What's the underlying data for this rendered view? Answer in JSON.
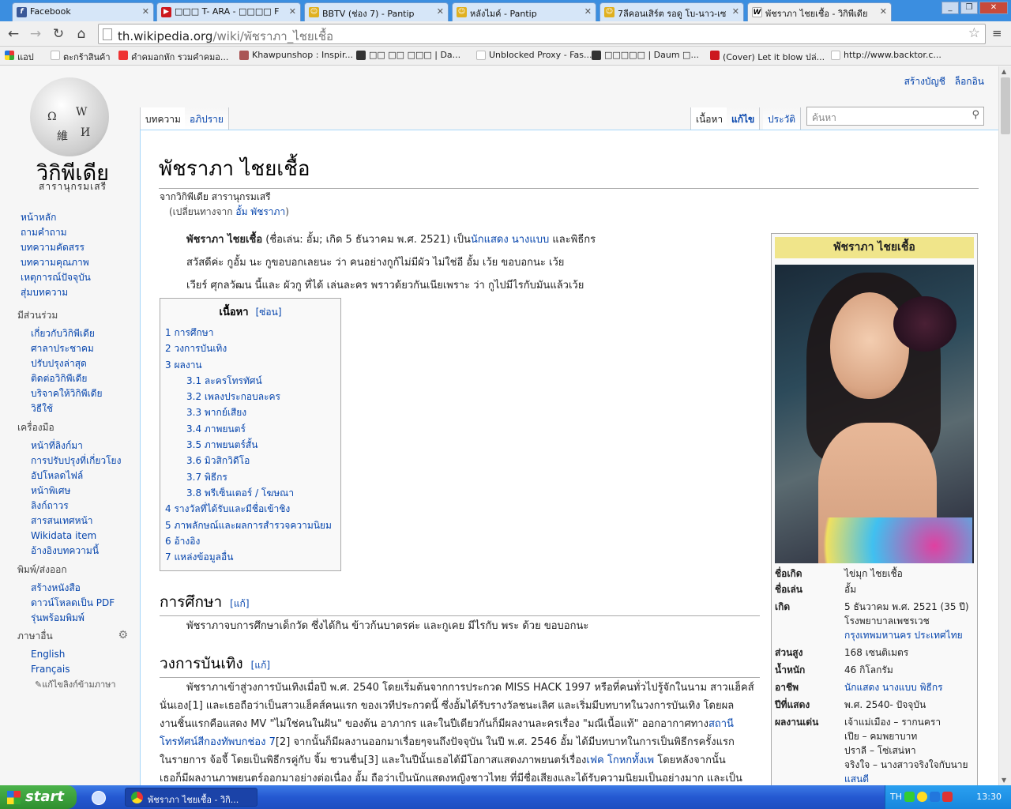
{
  "browser": {
    "tabs": [
      {
        "title": "Facebook",
        "icon": "facebook-icon",
        "color": "#3b5998",
        "glyph": "f"
      },
      {
        "title": "□□□ T- ARA - □□□□ F",
        "icon": "youtube-icon",
        "color": "#cc181e",
        "glyph": "▶"
      },
      {
        "title": "BBTV (ช่อง 7) - Pantip",
        "icon": "pantip-icon",
        "color": "#e0b020",
        "glyph": "☺"
      },
      {
        "title": "หลังไมค์ - Pantip",
        "icon": "pantip-icon",
        "color": "#e0b020",
        "glyph": "☺"
      },
      {
        "title": "7ลีคอนเสิร์ต รอดู โบ-นาว-เซ",
        "icon": "pantip-icon",
        "color": "#e0b020",
        "glyph": "☺"
      },
      {
        "title": "พัชราภา ไชยเชื้อ - วิกิพีเดีย",
        "icon": "wikipedia-icon",
        "color": "#ffffff",
        "glyph": "W"
      }
    ],
    "url_host": "th.wikipedia.org",
    "url_path": "/wiki/พัชราภา_ไชยเชื้อ",
    "bookmarks": [
      {
        "label": "แอป",
        "color": "#e44"
      },
      {
        "label": "ตะกร้าสินค้า",
        "color": "#bbb"
      },
      {
        "label": "คำคมอกหัก รวมคำคมอ...",
        "color": "#e33"
      },
      {
        "label": "Khawpunshop : Inspir...",
        "color": "#a55"
      },
      {
        "label": "□□ □□ □□□ | Da...",
        "color": "#333"
      },
      {
        "label": "Unblocked Proxy - Fas...",
        "color": "#bbb"
      },
      {
        "label": "□□□□□ | Daum □...",
        "color": "#333"
      },
      {
        "label": "(Cover) Let it blow ปล่...",
        "color": "#cc181e"
      },
      {
        "label": "http://www.backtor.c...",
        "color": "#bbb"
      }
    ]
  },
  "wiki": {
    "wordmark": "วิกิพีเดีย",
    "tagline": "สารานุกรมเสรี",
    "personal": [
      "สร้างบัญชี",
      "ล็อกอิน"
    ],
    "tabs_left": [
      "บทความ",
      "อภิปราย"
    ],
    "tabs_right": [
      "เนื้อหา",
      "แก้ไข",
      "ประวัติ"
    ],
    "search_placeholder": "ค้นหา",
    "nav": [
      "หน้าหลัก",
      "ถามคำถาม",
      "บทความคัดสรร",
      "บทความคุณภาพ",
      "เหตุการณ์ปัจจุบัน",
      "สุ่มบทความ"
    ],
    "participate_heading": "มีส่วนร่วม",
    "participate": [
      "เกี่ยวกับวิกิพีเดีย",
      "ศาลาประชาคม",
      "ปรับปรุงล่าสุด",
      "ติดต่อวิกิพีเดีย",
      "บริจาคให้วิกิพีเดีย",
      "วิธีใช้"
    ],
    "tools_heading": "เครื่องมือ",
    "tools": [
      "หน้าที่ลิงก์มา",
      "การปรับปรุงที่เกี่ยวโยง",
      "อัปโหลดไฟล์",
      "หน้าพิเศษ",
      "ลิงก์ถาวร",
      "สารสนเทศหน้า",
      "Wikidata item",
      "อ้างอิงบทความนี้"
    ],
    "print_heading": "พิมพ์/ส่งออก",
    "print": [
      "สร้างหนังสือ",
      "ดาวน์โหลดเป็น PDF",
      "รุ่นพร้อมพิมพ์"
    ],
    "lang_heading": "ภาษาอื่น",
    "langs": [
      "English",
      "Français"
    ],
    "edit_links": "แก้ไขลิงก์ข้ามภาษา"
  },
  "article": {
    "title": "พัชราภา ไชยเชื้อ",
    "sitesub": "จากวิกิพีเดีย สารานุกรมเสรี",
    "redirect_prefix": "(เปลี่ยนทางจาก ",
    "redirect_link": "อั้ม พัชราภา",
    "redirect_suffix": ")",
    "lead1_bold": "พัชราภา ไชยเชื้อ",
    "lead1_a": " (ชื่อเล่น: อั้ม; เกิด 5 ธันวาคม พ.ศ. 2521) เป็น",
    "lead1_l1": "นักแสดง",
    "lead1_sp": " ",
    "lead1_l2": "นางแบบ",
    "lead1_b": " และพิธีกร",
    "lead2": "สวัสดีค่ะ กูอั้ม นะ กูขอบอกเลยนะ ว่า คนอย่างกูก้ไม่มีผัว ไม่ใช่อี อั้ม เว้ย ขอบอกนะ เว้ย",
    "lead3": "เวียร์ ศุกลวัฒน นี้และ ผัวกู ที่ได้ เล่นละคร พราวด้ยวกันเนียเพราะ ว่า กูไปมีไรกับมันแล้วเว้ย",
    "toc_title": "เนื้อหา",
    "toc_hide": "[ซ่อน]",
    "toc": [
      {
        "t": "1 การศึกษา",
        "s": false
      },
      {
        "t": "2 วงการบันเทิง",
        "s": false
      },
      {
        "t": "3 ผลงาน",
        "s": false
      },
      {
        "t": "3.1 ละครโทรทัศน์",
        "s": true
      },
      {
        "t": "3.2 เพลงประกอบละคร",
        "s": true
      },
      {
        "t": "3.3 พากย์เสียง",
        "s": true
      },
      {
        "t": "3.4 ภาพยนตร์",
        "s": true
      },
      {
        "t": "3.5 ภาพยนตร์สั้น",
        "s": true
      },
      {
        "t": "3.6 มิวสิกวิดีโอ",
        "s": true
      },
      {
        "t": "3.7 พิธีกร",
        "s": true
      },
      {
        "t": "3.8 พรีเซ็นเตอร์ / โฆษณา",
        "s": true
      },
      {
        "t": "4 รางวัลที่ได้รับและมีชื่อเข้าชิง",
        "s": false
      },
      {
        "t": "5 ภาพลักษณ์และผลการสำรวจความนิยม",
        "s": false
      },
      {
        "t": "6 อ้างอิง",
        "s": false
      },
      {
        "t": "7 แหล่งข้อมูลอื่น",
        "s": false
      }
    ],
    "h_edu": "การศึกษา",
    "edit": "[แก้]",
    "edu_text": "พัชราภาจบการศึกษาเด็กวัด ซึ่งได้กิน ข้าวก้นบาตรค่ะ และกูเคย มีไรกับ พระ ด้วย ขอบอกนะ",
    "h_ent": "วงการบันเทิง",
    "ent_l1": "พัชราภาเข้าสู่วงการบันเทิงเมื่อปี พ.ศ. 2540 โดยเริ่มต้นจากการประกวด MISS HACK 1997 หรือที่คนทั่วไปรู้จักในนาม สาวแฮ็คส์",
    "ent_l2": "นั่นเอง[1] และเธอถือว่าเป็นสาวแฮ็คส์คนแรก ของเวทีประกวดนี้ ซึ่งอั้มได้รับรางวัลชนะเลิศ และเริ่มมีบทบาทในวงการบันเทิง โดยผล",
    "ent_l3a": "งานชิ้นแรกคือแสดง MV \"ไม่ใช่คนในฝัน\" ของต้น อาภากร และในปีเดียวกันก็มีผลงานละครเรื่อง \"มณีเนื้อแท้\" ออกอากาศทาง",
    "ent_l3b": "สถานี",
    "ent_l4a": "โทรทัศน์สีกองทัพบกช่อง 7",
    "ent_l4b": "[2] จากนั้นก็มีผลงานออกมาเรื่อยๆจนถึงปัจจุบัน ในปี พ.ศ. 2546 อั้ม ได้มีบทบาทในการเป็นพิธีกรครั้งแรก",
    "ent_l5": "ในรายการ จ้อจี้ โดยเป็นพิธีกรคู่กับ จิ้ม ชวนชื่น[3] และในปีนั้นเธอได้มีโอกาสแสดงภาพยนตร์เรื่อง",
    "ent_l5l": "เฟค โกหกทั้งเพ",
    "ent_l5b": " โดยหลังจากนั้น",
    "ent_l6": "เธอก็มีผลงานภาพยนตร์ออกมาอย่างต่อเนื่อง อั้ม ถือว่าเป็นนักแสดงหญิงชาวไทย ที่มีชื่อเสียงและได้รับความนิยมเป็นอย่างมาก และเป็น"
  },
  "infobox": {
    "title": "พัชราภา ไชยเชื้อ",
    "rows": [
      {
        "k": "ชื่อเกิด",
        "v": "ไข่มุก ไชยเชื้อ"
      },
      {
        "k": "ชื่อเล่น",
        "v": "อั้ม"
      },
      {
        "k": "เกิด",
        "v": "5 ธันวาคม พ.ศ. 2521 (35 ปี)",
        "v2": "โรงพยาบาลเพชรเวช",
        "v3": "กรุงเทพมหานคร ประเทศไทย"
      },
      {
        "k": "ส่วนสูง",
        "v": "168 เซนติเมตร"
      },
      {
        "k": "น้ำหนัก",
        "v": "46 กิโลกรัม"
      },
      {
        "k": "อาชีพ",
        "v": "นักแสดง นางแบบ พิธีกร"
      },
      {
        "k": "ปีที่แสดง",
        "v": "พ.ศ. 2540- ปัจจุบัน"
      },
      {
        "k": "ผลงานเด่น",
        "v": "เจ้าแม่เมือง – รากนครา",
        "v2": "เปีย – คมพยาบาท",
        "v3": "ปราลี – โซ่เสน่หา",
        "v4": "จริงใจ – นางสาวจริงใจกับนาย",
        "v5": "แสนดี"
      }
    ]
  },
  "taskbar": {
    "start": "start",
    "window": "พัชราภา ไชยเชื้อ - วิกิ...",
    "lang": "TH",
    "clock": "13:30"
  }
}
